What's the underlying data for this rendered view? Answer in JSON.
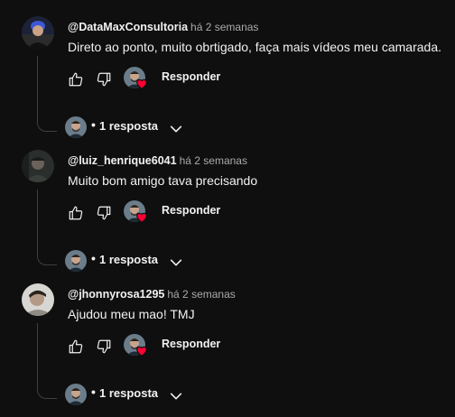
{
  "comments": [
    {
      "author": "@DataMaxConsultoria",
      "time": "há 2 semanas",
      "text": "Direto ao ponto, muito obrtigado, faça mais vídeos meu camarada.",
      "reply_label": "Responder",
      "replies_dot": "•",
      "replies_label": "1 resposta",
      "avatar": "blue-haired-man-avatar"
    },
    {
      "author": "@luiz_henrique6041",
      "time": "há 2 semanas",
      "text": "Muito bom amigo tava precisando",
      "reply_label": "Responder",
      "replies_dot": "•",
      "replies_label": "1 resposta",
      "avatar": "dark-photo-avatar"
    },
    {
      "author": "@jhonnyrosa1295",
      "time": "há 2 semanas",
      "text": "Ajudou meu mao! TMJ",
      "reply_label": "Responder",
      "replies_dot": "•",
      "replies_label": "1 resposta",
      "avatar": "light-photo-avatar"
    }
  ],
  "colors": {
    "background": "#0f0f0f",
    "text": "#f1f1f1",
    "secondary_text": "#aaaaaa",
    "heart": "#ff0033",
    "thread_line": "#3f3f3f"
  },
  "icons": [
    "like-icon",
    "dislike-icon",
    "creator-heart-icon",
    "chevron-down-icon"
  ]
}
